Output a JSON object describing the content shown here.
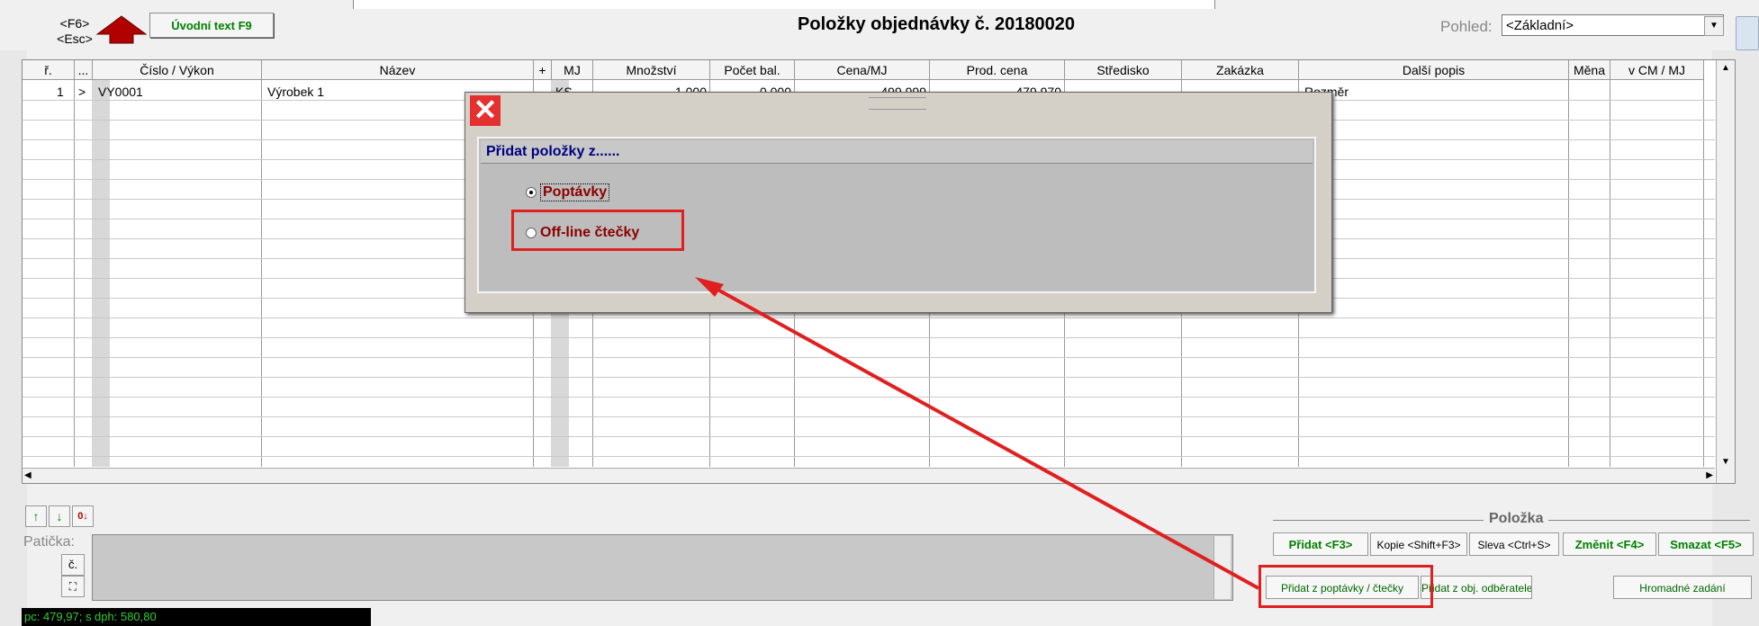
{
  "toolbar": {
    "f6_label": "<F6>",
    "esc_label": "<Esc>",
    "uvodni_text": "Úvodní text F9"
  },
  "window": {
    "title": "Položky objednávky č. 20180020"
  },
  "view": {
    "label": "Pohled:",
    "selected": "<Základní>"
  },
  "grid": {
    "columns": [
      "ř.",
      "...",
      "Číslo / Výkon",
      "Název",
      "+",
      "MJ",
      "Množství",
      "Počet bal.",
      "Cena/MJ",
      "Prod. cena",
      "Středisko",
      "Zakázka",
      "Další popis",
      "Měna",
      "v CM / MJ"
    ],
    "rows": [
      {
        "row": "1",
        "marker": ">",
        "cislo": "VY0001",
        "nazev": "Výrobek 1",
        "mj": "KS",
        "mnozstvi": "1,000",
        "pocet": "0,000",
        "cena": "499,999",
        "prod": "479,970",
        "dalsi": "Rozměr"
      }
    ]
  },
  "footer": {
    "paticka_label": "Patička:",
    "c_button": "č.",
    "status_text": "pc: 479,97; s dph: 580,80"
  },
  "polozka": {
    "group_label": "Položka",
    "pridat": "Přidat <F3>",
    "kopie": "Kopie <Shift+F3>",
    "sleva": "Sleva <Ctrl+S>",
    "zmenit": "Změnit <F4>",
    "smazat": "Smazat <F5>",
    "pridat_poptavky": "Přidat z poptávky / čtečky",
    "pridat_obj": "Přidat z obj. odběratele",
    "hromadne": "Hromadné zadání"
  },
  "dialog": {
    "title": "Přidat položky z......",
    "option_poptavky": "Poptávky",
    "option_offline": "Off-line čtečky",
    "selected_option": "Poptávky"
  },
  "colors": {
    "highlight": "#e02020",
    "dialog_title": "#000080",
    "option_label": "#8b0000",
    "status_text": "#33cc33"
  }
}
